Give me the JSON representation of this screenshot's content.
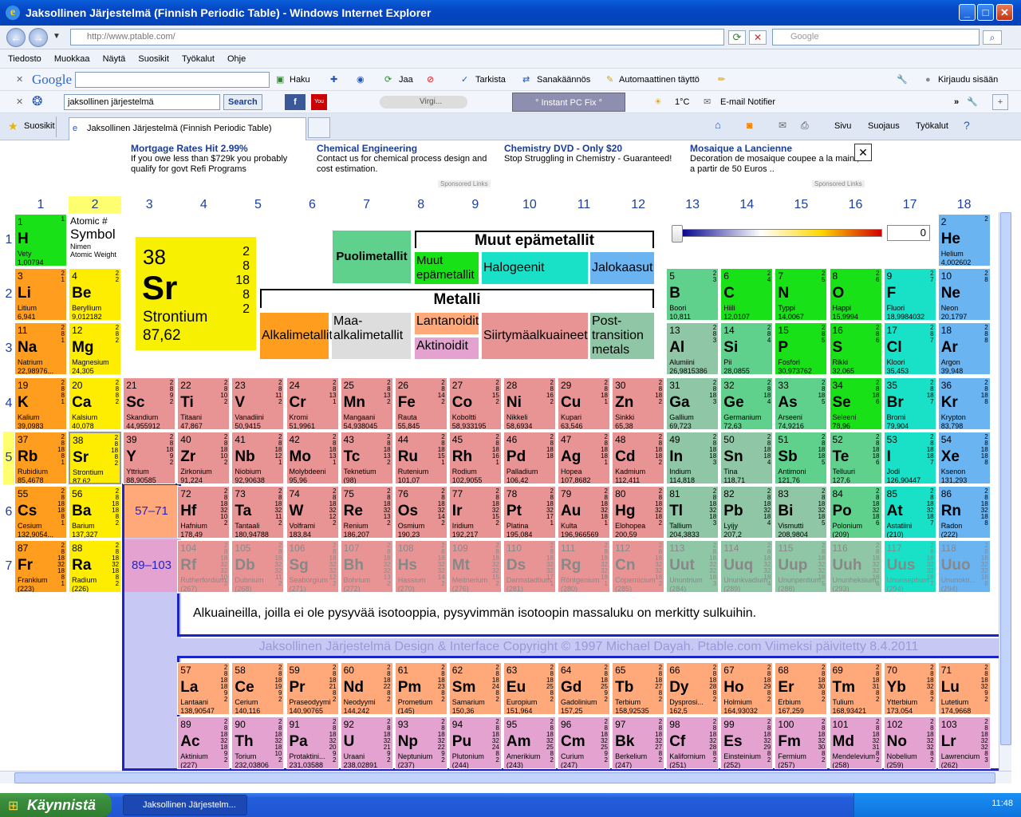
{
  "window": {
    "title": "Jaksollinen Järjestelmä (Finnish Periodic Table) - Windows Internet Explorer"
  },
  "address": {
    "url": "http://www.ptable.com/",
    "search_placeholder": "Google"
  },
  "menu": [
    "Tiedosto",
    "Muokkaa",
    "Näytä",
    "Suosikit",
    "Työkalut",
    "Ohje"
  ],
  "google_toolbar": {
    "logo": "Google",
    "items": [
      "Haku",
      "Jaa",
      "Tarkista",
      "Sanakäännös",
      "Automaattinen täyttö",
      "Kirjaudu sisään"
    ]
  },
  "toolbar2": {
    "query": "jaksollinen järjestelmä",
    "search": "Search",
    "media": "Virgi...",
    "instant": "° Instant PC Fix °",
    "temp": "1°C",
    "email": "E-mail Notifier"
  },
  "tabs": {
    "favorites": "Suosikit",
    "active": "Jaksollinen Järjestelmä (Finnish Periodic Table)",
    "cmd": [
      "Sivu",
      "Suojaus",
      "Työkalut"
    ]
  },
  "ads": [
    {
      "h": "Mortgage Rates Hit 2.99%",
      "t": "If you owe less than $729k you probably qualify for govt Refi Programs"
    },
    {
      "h": "Chemical Engineering",
      "t": "Contact us for chemical process design and cost estimation."
    },
    {
      "h": "Chemistry DVD - Only $20",
      "t": "Stop Struggling in Chemistry - Guaranteed!"
    },
    {
      "h": "Mosaique a Lancienne",
      "t": "Decoration de mosaique coupee a la main , a partir de 50 Euros .."
    }
  ],
  "sponsored": "Sponsored Links",
  "groups": [
    "1",
    "2",
    "3",
    "4",
    "5",
    "6",
    "7",
    "8",
    "9",
    "10",
    "11",
    "12",
    "13",
    "14",
    "15",
    "16",
    "17",
    "18"
  ],
  "periods": [
    "1",
    "2",
    "3",
    "4",
    "5",
    "6",
    "7"
  ],
  "legend_key": {
    "atomic": "Atomic #",
    "symbol": "Symbol",
    "name": "Nimen",
    "weight": "Atomic Weight"
  },
  "featured": {
    "n": "38",
    "s": "Sr",
    "name": "Strontium",
    "w": "87,62",
    "shells": "2\n8\n18\n8\n2"
  },
  "legend": {
    "metalloids": "Puolimetallit",
    "other_nonmetals": "Muut epämetallit",
    "nonmetals": "Muut epämetallit",
    "halogens": "Halogeenit",
    "noble": "Jalokaasut",
    "metals": "Metalli",
    "alkali": "Alkalimetallit",
    "alkaline": "Maa-alkalimetallit",
    "lanthanoids": "Lantanoidit",
    "actinoids": "Aktinoidit",
    "transition": "Siirtymäalkuaineet",
    "post": "Post-transition metals"
  },
  "slider_value": "0",
  "lan_ref": "57–71",
  "act_ref": "89–103",
  "note": "Alkuaineilla, joilla ei ole pysyvää isotooppia, pysyvimmän isotoopin massaluku on merkitty sulkuihin.",
  "copyright": "Jaksollinen Järjestelmä Design & Interface Copyright © 1997 Michael Dayah. Ptable.com Viimeksi päivitetty 8.4.2011",
  "taskbar": {
    "start": "Käynnistä",
    "task": "Jaksollinen Järjestelm...",
    "clock": "11:48"
  },
  "elements": [
    [
      "1",
      "H",
      "Vety",
      "1,00794",
      "1",
      1,
      1,
      "nm2"
    ],
    [
      "2",
      "He",
      "Helium",
      "4,002602",
      "2",
      18,
      1,
      "nob"
    ],
    [
      "3",
      "Li",
      "Litium",
      "6,941",
      "2\n1",
      1,
      2,
      "alk"
    ],
    [
      "4",
      "Be",
      "Beryllium",
      "9,012182",
      "2\n2",
      2,
      2,
      "ae"
    ],
    [
      "5",
      "B",
      "Boori",
      "10,811",
      "2\n3",
      13,
      2,
      "met"
    ],
    [
      "6",
      "C",
      "Hiili",
      "12,0107",
      "2\n4",
      14,
      2,
      "nm2"
    ],
    [
      "7",
      "N",
      "Typpi",
      "14,0067",
      "2\n5",
      15,
      2,
      "nm2"
    ],
    [
      "8",
      "O",
      "Happi",
      "15,9994",
      "2\n6",
      16,
      2,
      "nm2"
    ],
    [
      "9",
      "F",
      "Fluori",
      "18,9984032",
      "2\n7",
      17,
      2,
      "hal"
    ],
    [
      "10",
      "Ne",
      "Neon",
      "20,1797",
      "2\n8",
      18,
      2,
      "nob"
    ],
    [
      "11",
      "Na",
      "Natrium",
      "22,98976...",
      "2\n8\n1",
      1,
      3,
      "alk"
    ],
    [
      "12",
      "Mg",
      "Magnesium",
      "24,305",
      "2\n8\n2",
      2,
      3,
      "ae"
    ],
    [
      "13",
      "Al",
      "Alumiini",
      "26,9815386",
      "2\n8\n3",
      13,
      3,
      "pt"
    ],
    [
      "14",
      "Si",
      "Pii",
      "28,0855",
      "2\n8\n4",
      14,
      3,
      "met"
    ],
    [
      "15",
      "P",
      "Fosfori",
      "30,973762",
      "2\n8\n5",
      15,
      3,
      "nm2"
    ],
    [
      "16",
      "S",
      "Rikki",
      "32,065",
      "2\n8\n6",
      16,
      3,
      "nm2"
    ],
    [
      "17",
      "Cl",
      "Kloori",
      "35,453",
      "2\n8\n7",
      17,
      3,
      "hal"
    ],
    [
      "18",
      "Ar",
      "Argon",
      "39,948",
      "2\n8\n8",
      18,
      3,
      "nob"
    ],
    [
      "19",
      "K",
      "Kalium",
      "39,0983",
      "2\n8\n8\n1",
      1,
      4,
      "alk"
    ],
    [
      "20",
      "Ca",
      "Kalsium",
      "40,078",
      "2\n8\n8\n2",
      2,
      4,
      "ae"
    ],
    [
      "21",
      "Sc",
      "Skandium",
      "44,955912",
      "2\n8\n9\n2",
      3,
      4,
      "tm"
    ],
    [
      "22",
      "Ti",
      "Titaani",
      "47,867",
      "2\n8\n10\n2",
      4,
      4,
      "tm"
    ],
    [
      "23",
      "V",
      "Vanadiini",
      "50,9415",
      "2\n8\n11\n2",
      5,
      4,
      "tm"
    ],
    [
      "24",
      "Cr",
      "Kromi",
      "51,9961",
      "2\n8\n13\n1",
      6,
      4,
      "tm"
    ],
    [
      "25",
      "Mn",
      "Mangaani",
      "54,938045",
      "2\n8\n13\n2",
      7,
      4,
      "tm"
    ],
    [
      "26",
      "Fe",
      "Rauta",
      "55,845",
      "2\n8\n14\n2",
      8,
      4,
      "tm"
    ],
    [
      "27",
      "Co",
      "Koboltti",
      "58,933195",
      "2\n8\n15\n2",
      9,
      4,
      "tm"
    ],
    [
      "28",
      "Ni",
      "Nikkeli",
      "58,6934",
      "2\n8\n16\n2",
      10,
      4,
      "tm"
    ],
    [
      "29",
      "Cu",
      "Kupari",
      "63,546",
      "2\n8\n18\n1",
      11,
      4,
      "tm"
    ],
    [
      "30",
      "Zn",
      "Sinkki",
      "65,38",
      "2\n8\n18\n2",
      12,
      4,
      "tm"
    ],
    [
      "31",
      "Ga",
      "Gallium",
      "69,723",
      "2\n8\n18\n3",
      13,
      4,
      "pt"
    ],
    [
      "32",
      "Ge",
      "Germanium",
      "72,63",
      "2\n8\n18\n4",
      14,
      4,
      "met"
    ],
    [
      "33",
      "As",
      "Arseeni",
      "74,9216",
      "2\n8\n18\n5",
      15,
      4,
      "met"
    ],
    [
      "34",
      "Se",
      "Seleeni",
      "78,96",
      "2\n8\n18\n6",
      16,
      4,
      "nm2"
    ],
    [
      "35",
      "Br",
      "Bromi",
      "79,904",
      "2\n8\n18\n7",
      17,
      4,
      "hal"
    ],
    [
      "36",
      "Kr",
      "Krypton",
      "83,798",
      "2\n8\n18\n8",
      18,
      4,
      "nob"
    ],
    [
      "37",
      "Rb",
      "Rubidium",
      "85,4678",
      "2\n8\n18\n8\n1",
      1,
      5,
      "alk"
    ],
    [
      "38",
      "Sr",
      "Strontium",
      "87,62",
      "2\n8\n18\n8\n2",
      2,
      5,
      "ae"
    ],
    [
      "39",
      "Y",
      "Yttrium",
      "88,90585",
      "2\n8\n18\n9\n2",
      3,
      5,
      "tm"
    ],
    [
      "40",
      "Zr",
      "Zirkonium",
      "91,224",
      "2\n8\n18\n10\n2",
      4,
      5,
      "tm"
    ],
    [
      "41",
      "Nb",
      "Niobium",
      "92,90638",
      "2\n8\n18\n12\n1",
      5,
      5,
      "tm"
    ],
    [
      "42",
      "Mo",
      "Molybdeeni",
      "95,96",
      "2\n8\n18\n13\n1",
      6,
      5,
      "tm"
    ],
    [
      "43",
      "Tc",
      "Teknetium",
      "(98)",
      "2\n8\n18\n13\n2",
      7,
      5,
      "tm"
    ],
    [
      "44",
      "Ru",
      "Rutenium",
      "101,07",
      "2\n8\n18\n15\n1",
      8,
      5,
      "tm"
    ],
    [
      "45",
      "Rh",
      "Rodium",
      "102,9055",
      "2\n8\n18\n16\n1",
      9,
      5,
      "tm"
    ],
    [
      "46",
      "Pd",
      "Palladium",
      "106,42",
      "2\n8\n18\n18",
      10,
      5,
      "tm"
    ],
    [
      "47",
      "Ag",
      "Hopea",
      "107,8682",
      "2\n8\n18\n18\n1",
      11,
      5,
      "tm"
    ],
    [
      "48",
      "Cd",
      "Kadmium",
      "112,411",
      "2\n8\n18\n18\n2",
      12,
      5,
      "tm"
    ],
    [
      "49",
      "In",
      "Indium",
      "114,818",
      "2\n8\n18\n18\n3",
      13,
      5,
      "pt"
    ],
    [
      "50",
      "Sn",
      "Tina",
      "118,71",
      "2\n8\n18\n18\n4",
      14,
      5,
      "pt"
    ],
    [
      "51",
      "Sb",
      "Antimoni",
      "121,76",
      "2\n8\n18\n18\n5",
      15,
      5,
      "met"
    ],
    [
      "52",
      "Te",
      "Telluuri",
      "127,6",
      "2\n8\n18\n18\n6",
      16,
      5,
      "met"
    ],
    [
      "53",
      "I",
      "Jodi",
      "126,90447",
      "2\n8\n18\n18\n7",
      17,
      5,
      "hal"
    ],
    [
      "54",
      "Xe",
      "Ksenon",
      "131,293",
      "2\n8\n18\n18\n8",
      18,
      5,
      "nob"
    ],
    [
      "55",
      "Cs",
      "Cesium",
      "132,9054...",
      "2\n8\n18\n18\n8\n1",
      1,
      6,
      "alk"
    ],
    [
      "56",
      "Ba",
      "Barium",
      "137,327",
      "2\n8\n18\n18\n8\n2",
      2,
      6,
      "ae"
    ],
    [
      "72",
      "Hf",
      "Hafnium",
      "178,49",
      "2\n8\n18\n32\n10\n2",
      4,
      6,
      "tm"
    ],
    [
      "73",
      "Ta",
      "Tantaali",
      "180,94788",
      "2\n8\n18\n32\n11\n2",
      5,
      6,
      "tm"
    ],
    [
      "74",
      "W",
      "Volframi",
      "183,84",
      "2\n8\n18\n32\n12\n2",
      6,
      6,
      "tm"
    ],
    [
      "75",
      "Re",
      "Renium",
      "186,207",
      "2\n8\n18\n32\n13\n2",
      7,
      6,
      "tm"
    ],
    [
      "76",
      "Os",
      "Osmium",
      "190,23",
      "2\n8\n18\n32\n14\n2",
      8,
      6,
      "tm"
    ],
    [
      "77",
      "Ir",
      "Iridium",
      "192,217",
      "2\n8\n18\n32\n15\n2",
      9,
      6,
      "tm"
    ],
    [
      "78",
      "Pt",
      "Platina",
      "195,084",
      "2\n8\n18\n32\n17\n1",
      10,
      6,
      "tm"
    ],
    [
      "79",
      "Au",
      "Kulta",
      "196,966569",
      "2\n8\n18\n32\n18\n1",
      11,
      6,
      "tm"
    ],
    [
      "80",
      "Hg",
      "Elohopea",
      "200,59",
      "2\n8\n18\n32\n18\n2",
      12,
      6,
      "tm"
    ],
    [
      "81",
      "Tl",
      "Tallium",
      "204,3833",
      "2\n8\n18\n32\n18\n3",
      13,
      6,
      "pt"
    ],
    [
      "82",
      "Pb",
      "Lyijy",
      "207,2",
      "2\n8\n18\n32\n18\n4",
      14,
      6,
      "pt"
    ],
    [
      "83",
      "Bi",
      "Vismutti",
      "208,9804",
      "2\n8\n18\n32\n18\n5",
      15,
      6,
      "pt"
    ],
    [
      "84",
      "Po",
      "Polonium",
      "(209)",
      "2\n8\n18\n32\n18\n6",
      16,
      6,
      "met"
    ],
    [
      "85",
      "At",
      "Astatiini",
      "(210)",
      "2\n8\n18\n32\n18\n7",
      17,
      6,
      "hal"
    ],
    [
      "86",
      "Rn",
      "Radon",
      "(222)",
      "2\n8\n18\n32\n18\n8",
      18,
      6,
      "nob"
    ],
    [
      "87",
      "Fr",
      "Frankium",
      "(223)",
      "2\n8\n18\n32\n18\n8\n1",
      1,
      7,
      "alk"
    ],
    [
      "88",
      "Ra",
      "Radium",
      "(226)",
      "2\n8\n18\n32\n18\n8\n2",
      2,
      7,
      "ae"
    ],
    [
      "104",
      "Rf",
      "Rutherfordium",
      "(267)",
      "2\n8\n18\n32\n32\n10\n2",
      4,
      7,
      "tm syn"
    ],
    [
      "105",
      "Db",
      "Dubnium",
      "(268)",
      "2\n8\n18\n32\n32\n11\n2",
      5,
      7,
      "tm syn"
    ],
    [
      "106",
      "Sg",
      "Seaborgium",
      "(271)",
      "2\n8\n18\n32\n32\n12\n2",
      6,
      7,
      "tm syn"
    ],
    [
      "107",
      "Bh",
      "Bohrium",
      "(272)",
      "2\n8\n18\n32\n32\n13\n2",
      7,
      7,
      "tm syn"
    ],
    [
      "108",
      "Hs",
      "Hassium",
      "(270)",
      "2\n8\n18\n32\n32\n14\n2",
      8,
      7,
      "tm syn"
    ],
    [
      "109",
      "Mt",
      "Meitnerium",
      "(276)",
      "2\n8\n18\n32\n32\n15\n2",
      9,
      7,
      "tm syn"
    ],
    [
      "110",
      "Ds",
      "Darmstadtium",
      "(281)",
      "2\n8\n18\n32\n32\n17\n1",
      10,
      7,
      "tm syn"
    ],
    [
      "111",
      "Rg",
      "Röntgenium",
      "(280)",
      "2\n8\n18\n32\n32\n18\n1",
      11,
      7,
      "tm syn"
    ],
    [
      "112",
      "Cn",
      "Copernicium",
      "(285)",
      "2\n8\n18\n32\n32\n18\n2",
      12,
      7,
      "tm syn"
    ],
    [
      "113",
      "Uut",
      "Ununtrium",
      "(284)",
      "2\n8\n18\n32\n32\n18\n3",
      13,
      7,
      "unk syn"
    ],
    [
      "114",
      "Uuq",
      "Ununkvadium",
      "(289)",
      "2\n8\n18\n32\n32\n18\n4",
      14,
      7,
      "unk syn"
    ],
    [
      "115",
      "Uup",
      "Ununpentium",
      "(288)",
      "2\n8\n18\n32\n32\n18\n5",
      15,
      7,
      "unk syn"
    ],
    [
      "116",
      "Uuh",
      "Ununheksium",
      "(293)",
      "2\n8\n18\n32\n32\n18\n6",
      16,
      7,
      "unk syn"
    ],
    [
      "117",
      "Uus",
      "Ununseptium",
      "(294)",
      "2\n8\n18\n32\n32\n18\n7",
      17,
      7,
      "hal syn"
    ],
    [
      "118",
      "Uuo",
      "Ununokti...",
      "(294)",
      "2\n8\n18\n32\n32\n18\n8",
      18,
      7,
      "nob syn"
    ],
    [
      "57",
      "La",
      "Lantaani",
      "138,90547",
      "2\n8\n18\n18\n9\n2",
      4,
      9,
      "lan"
    ],
    [
      "58",
      "Ce",
      "Cerium",
      "140,116",
      "2\n8\n18\n19\n9\n2",
      5,
      9,
      "lan"
    ],
    [
      "59",
      "Pr",
      "Praseodyymi",
      "140,90765",
      "2\n8\n18\n21\n8\n2",
      6,
      9,
      "lan"
    ],
    [
      "60",
      "Nd",
      "Neodyymi",
      "144,242",
      "2\n8\n18\n22\n8\n2",
      7,
      9,
      "lan"
    ],
    [
      "61",
      "Pm",
      "Prometium",
      "(145)",
      "2\n8\n18\n23\n8\n2",
      8,
      9,
      "lan"
    ],
    [
      "62",
      "Sm",
      "Samarium",
      "150,36",
      "2\n8\n18\n24\n8\n2",
      9,
      9,
      "lan"
    ],
    [
      "63",
      "Eu",
      "Europium",
      "151,964",
      "2\n8\n18\n25\n8\n2",
      10,
      9,
      "lan"
    ],
    [
      "64",
      "Gd",
      "Gadolinium",
      "157,25",
      "2\n8\n18\n25\n9\n2",
      11,
      9,
      "lan"
    ],
    [
      "65",
      "Tb",
      "Terbium",
      "158,92535",
      "2\n8\n18\n27\n8\n2",
      12,
      9,
      "lan"
    ],
    [
      "66",
      "Dy",
      "Dysprosi...",
      "162,5",
      "2\n8\n18\n28\n8\n2",
      13,
      9,
      "lan"
    ],
    [
      "67",
      "Ho",
      "Holmium",
      "164,93032",
      "2\n8\n18\n29\n8\n2",
      14,
      9,
      "lan"
    ],
    [
      "68",
      "Er",
      "Erbium",
      "167,259",
      "2\n8\n18\n30\n8\n2",
      15,
      9,
      "lan"
    ],
    [
      "69",
      "Tm",
      "Tulium",
      "168,93421",
      "2\n8\n18\n31\n8\n2",
      16,
      9,
      "lan"
    ],
    [
      "70",
      "Yb",
      "Ytterbium",
      "173,054",
      "2\n8\n18\n32\n8\n2",
      17,
      9,
      "lan"
    ],
    [
      "71",
      "Lu",
      "Lutetium",
      "174,9668",
      "2\n8\n18\n32\n9\n2",
      18,
      9,
      "lan"
    ],
    [
      "89",
      "Ac",
      "Aktinium",
      "(227)",
      "2\n8\n18\n32\n18\n9\n2",
      4,
      10,
      "act"
    ],
    [
      "90",
      "Th",
      "Torium",
      "232,03806",
      "2\n8\n18\n32\n18\n10\n2",
      5,
      10,
      "act"
    ],
    [
      "91",
      "Pa",
      "Protaktini...",
      "231,03588",
      "2\n8\n18\n32\n20\n9\n2",
      6,
      10,
      "act"
    ],
    [
      "92",
      "U",
      "Uraani",
      "238,02891",
      "2\n8\n18\n32\n21\n9\n2",
      7,
      10,
      "act"
    ],
    [
      "93",
      "Np",
      "Neptunium",
      "(237)",
      "2\n8\n18\n32\n22\n9\n2",
      8,
      10,
      "act"
    ],
    [
      "94",
      "Pu",
      "Plutonium",
      "(244)",
      "2\n8\n18\n32\n24\n8\n2",
      9,
      10,
      "act"
    ],
    [
      "95",
      "Am",
      "Amerikium",
      "(243)",
      "2\n8\n18\n32\n25\n8\n2",
      10,
      10,
      "act"
    ],
    [
      "96",
      "Cm",
      "Curium",
      "(247)",
      "2\n8\n18\n32\n25\n9\n2",
      11,
      10,
      "act"
    ],
    [
      "97",
      "Bk",
      "Berkelium",
      "(247)",
      "2\n8\n18\n32\n27\n8\n2",
      12,
      10,
      "act"
    ],
    [
      "98",
      "Cf",
      "Kalifornium",
      "(251)",
      "2\n8\n18\n32\n28\n8\n2",
      13,
      10,
      "act"
    ],
    [
      "99",
      "Es",
      "Einsteinium",
      "(252)",
      "2\n8\n18\n32\n29\n8\n2",
      14,
      10,
      "act"
    ],
    [
      "100",
      "Fm",
      "Fermium",
      "(257)",
      "2\n8\n18\n32\n30\n8\n2",
      15,
      10,
      "act"
    ],
    [
      "101",
      "Md",
      "Mendelevium",
      "(258)",
      "2\n8\n18\n32\n31\n8\n2",
      16,
      10,
      "act"
    ],
    [
      "102",
      "No",
      "Nobelium",
      "(259)",
      "2\n8\n18\n32\n32\n8\n2",
      17,
      10,
      "act"
    ],
    [
      "103",
      "Lr",
      "Lawrencium",
      "(262)",
      "2\n8\n18\n32\n32\n8\n3",
      18,
      10,
      "act"
    ]
  ]
}
